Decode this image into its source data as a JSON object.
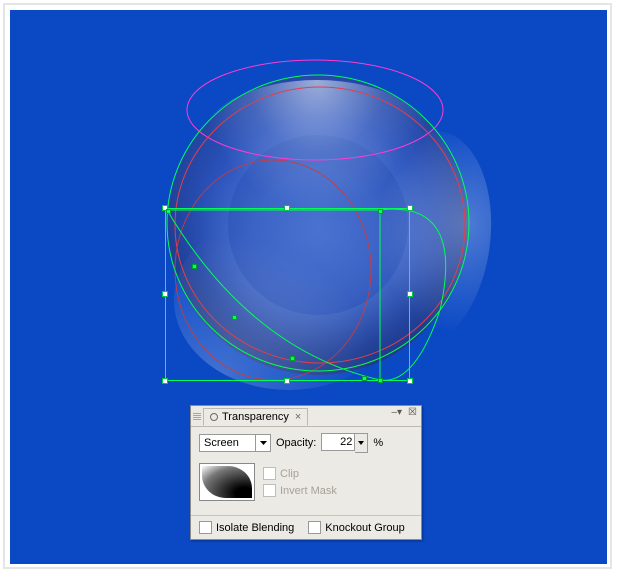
{
  "panel": {
    "tab_label": "Transparency",
    "blend_mode": "Screen",
    "opacity_label": "Opacity:",
    "opacity_value": "22",
    "opacity_unit": "%",
    "clip_label": "Clip",
    "invert_mask_label": "Invert Mask",
    "isolate_blending_label": "Isolate Blending",
    "knockout_group_label": "Knockout Group"
  },
  "canvas": {
    "background_color": "#0a48c4",
    "selection_color": "#00ff55",
    "accent_magenta": "#ff3cd2",
    "accent_red": "#e0404a"
  }
}
